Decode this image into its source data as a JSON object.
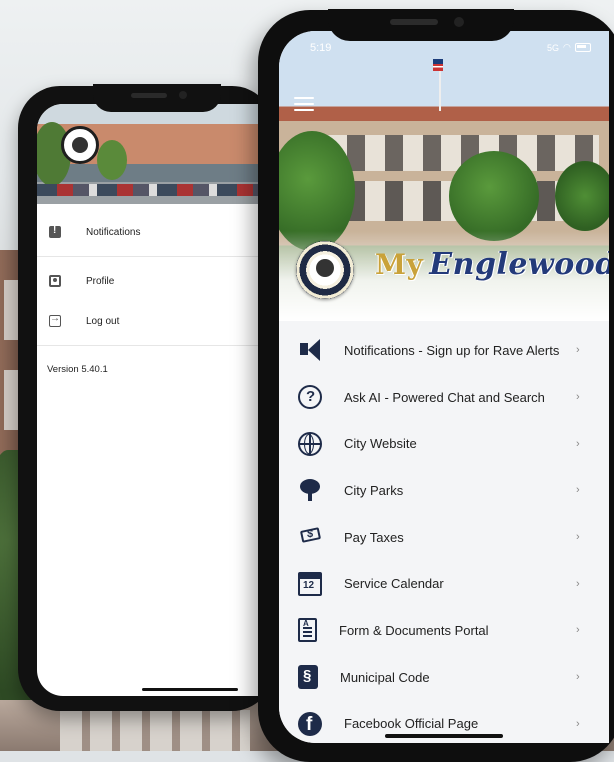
{
  "background": {
    "accent": "#1e2b49"
  },
  "back_phone": {
    "drawer": {
      "items": [
        {
          "icon": "alert-flag-icon",
          "label": "Notifications"
        },
        {
          "icon": "profile-icon",
          "label": "Profile"
        },
        {
          "icon": "logout-icon",
          "label": "Log out"
        }
      ],
      "version": "Version 5.40.1"
    }
  },
  "front_phone": {
    "status_bar": {
      "time": "5:19",
      "network": "5G"
    },
    "brand": {
      "my": "My",
      "name": "Englewood"
    },
    "menu": [
      {
        "icon": "megaphone-icon",
        "label": "Notifications - Sign up for Rave Alerts"
      },
      {
        "icon": "question-circle-icon",
        "label": "Ask AI - Powered Chat and Search"
      },
      {
        "icon": "globe-icon",
        "label": "City Website"
      },
      {
        "icon": "tree-icon",
        "label": "City Parks"
      },
      {
        "icon": "money-hand-icon",
        "label": "Pay Taxes"
      },
      {
        "icon": "calendar-icon",
        "label": "Service Calendar"
      },
      {
        "icon": "document-icon",
        "label": "Form & Documents Portal"
      },
      {
        "icon": "section-icon",
        "label": "Municipal Code"
      },
      {
        "icon": "facebook-icon",
        "label": "Facebook Official Page"
      }
    ],
    "chevron": "›"
  }
}
